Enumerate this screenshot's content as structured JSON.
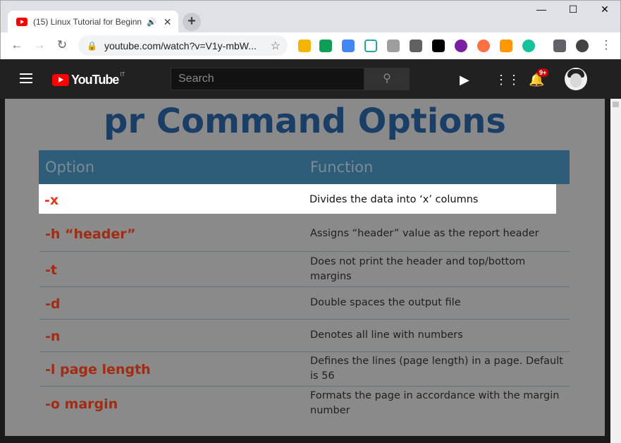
{
  "browser": {
    "tab_title": "(15) Linux Tutorial for Beginn",
    "url": "youtube.com/watch?v=V1y-mbW...",
    "new_tab_symbol": "+",
    "minimize_symbol": "—",
    "maximize_symbol": "☐",
    "close_symbol": "✕"
  },
  "youtube": {
    "brand": "YouTube",
    "country_code": "IT",
    "search_placeholder": "Search",
    "notification_count": "9+"
  },
  "slide": {
    "title": "pr Command Options",
    "headers": {
      "option": "Option",
      "function": "Function"
    },
    "rows": [
      {
        "option": "-x",
        "function": "Divides the data into ‘x’ columns",
        "highlighted": true
      },
      {
        "option": "-h “header”",
        "function": "Assigns “header” value as the report header",
        "highlighted": false
      },
      {
        "option": "-t",
        "function": "Does not print the header and top/bottom margins",
        "highlighted": false
      },
      {
        "option": "-d",
        "function": "Double spaces the output file",
        "highlighted": false
      },
      {
        "option": "-n",
        "function": "Denotes all line with numbers",
        "highlighted": false
      },
      {
        "option": "-l page length",
        "function": "Defines the lines (page length) in a page. Default is 56",
        "highlighted": false
      },
      {
        "option": "-o margin",
        "function": "Formats the page in accordance with the margin number",
        "highlighted": false
      }
    ]
  },
  "colors": {
    "youtube_red": "#ff0000",
    "slide_title": "#1b3e66",
    "table_header": "#2e5d7a",
    "option_text": "#e03a1c"
  }
}
